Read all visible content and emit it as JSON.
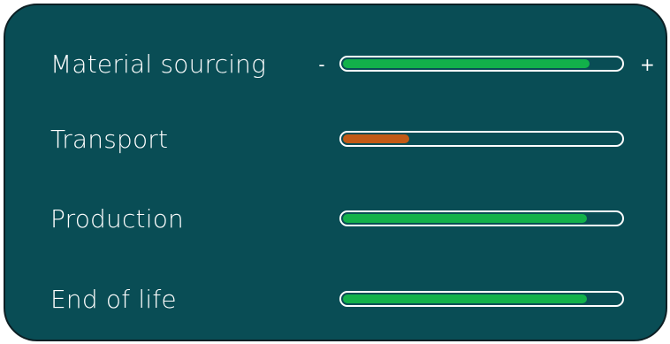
{
  "colors": {
    "panel_background": "#094d55",
    "track_border": "#ffffff",
    "positive_fill": "#12b14a",
    "negative_fill": "#c35a16"
  },
  "controls": {
    "decrease_label": "-",
    "increase_label": "+"
  },
  "rows": [
    {
      "label": "Material sourcing",
      "level": 0.89,
      "color": "#12b14a",
      "has_stepper": true
    },
    {
      "label": "Transport",
      "level": 0.24,
      "color": "#c35a16",
      "has_stepper": false
    },
    {
      "label": "Production",
      "level": 0.88,
      "color": "#12b14a",
      "has_stepper": false
    },
    {
      "label": "End of life",
      "level": 0.88,
      "color": "#12b14a",
      "has_stepper": false
    }
  ]
}
